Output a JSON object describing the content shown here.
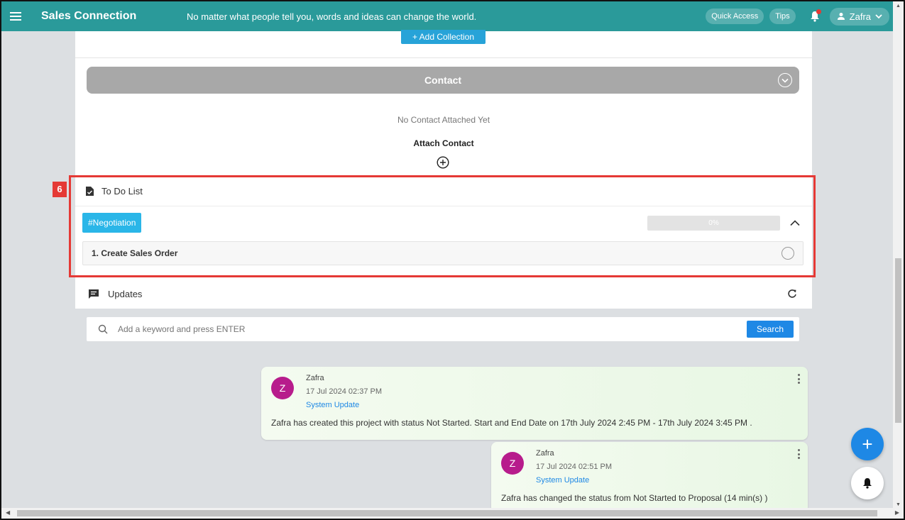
{
  "header": {
    "brand": "Sales Connection",
    "tagline": "No matter what people tell you, words and ideas can change the world.",
    "quick_access": "Quick Access",
    "tips": "Tips",
    "user_name": "Zafra"
  },
  "collection": {
    "add_label": "+ Add Collection"
  },
  "contact": {
    "title": "Contact",
    "empty_text": "No Contact Attached Yet",
    "attach_label": "Attach Contact"
  },
  "annotation": {
    "badge": "6"
  },
  "todo": {
    "title": "To Do List",
    "tag": "#Negotiation",
    "progress_label": "0%",
    "progress_fraction": 0,
    "tasks": [
      {
        "label": "1. Create Sales Order"
      }
    ]
  },
  "updates": {
    "title": "Updates",
    "search_placeholder": "Add a keyword and press ENTER",
    "search_button": "Search",
    "messages": [
      {
        "avatar": "Z",
        "author": "Zafra",
        "time": "17 Jul 2024 02:37 PM",
        "type": "System Update",
        "text": "Zafra has created this project with status Not Started. Start and End Date on 17th July 2024 2:45 PM - 17th July 2024 3:45 PM ."
      },
      {
        "avatar": "Z",
        "author": "Zafra",
        "time": "17 Jul 2024 02:51 PM",
        "type": "System Update",
        "text": "Zafra has changed the status from Not Started to Proposal (14 min(s) )"
      }
    ]
  },
  "fab": {
    "add_label": "+"
  },
  "colors": {
    "header": "#2a9a9a",
    "highlight": "#e53935",
    "tag": "#2ab6e8",
    "primary": "#1e88e5",
    "avatar": "#b71c8c"
  }
}
